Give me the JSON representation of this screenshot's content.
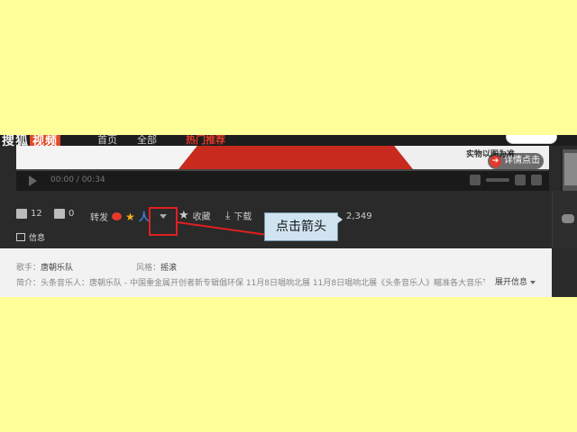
{
  "top_nav": {
    "logo_text": "搜狐",
    "logo_badge": "视频",
    "items": [
      "首页",
      "全部"
    ],
    "highlight_text": "热门推荐"
  },
  "video": {
    "overlay_text": "实物以图为准",
    "detail_button": "详情点击",
    "time_current": "00:00",
    "time_total": "00:34"
  },
  "actions": {
    "like_count": "12",
    "dislike_count": "0",
    "share_label": "转发",
    "favorite_label": "收藏",
    "download_label": "下载",
    "play_count": "2,349",
    "info_tab": "信息"
  },
  "annotation": {
    "callout_text": "点击箭头",
    "box_color": "#e02020",
    "callout_bg": "#cfe4f0"
  },
  "details": {
    "singer_label": "歌手：",
    "singer_value": "唐朝乐队",
    "genre_label": "风格：",
    "genre_value": "摇滚",
    "intro_label": "简介：",
    "intro_text": "头条音乐人：唐朝乐队 - 中国重金属开创者新专辑倡环保 11月8日唱响北展 11月8日唱响北展《头条音乐人》瞄准各大音乐节",
    "expand_label": "展开信息"
  },
  "colors": {
    "page_bg": "#ffff99",
    "accent_red": "#e23a2a",
    "dark_bg": "#2a2a2a"
  }
}
